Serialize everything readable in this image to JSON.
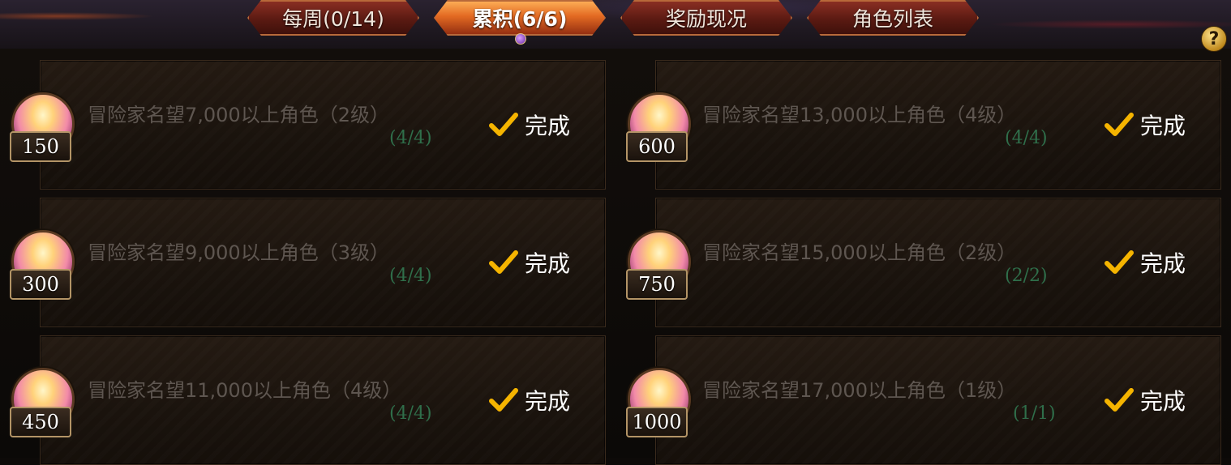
{
  "tabs": [
    {
      "label": "每周(0/14)",
      "active": false
    },
    {
      "label": "累积(6/6)",
      "active": true
    },
    {
      "label": "奖励现况",
      "active": false
    },
    {
      "label": "角色列表",
      "active": false
    }
  ],
  "help": {
    "label": "?"
  },
  "quests": [
    {
      "reward": "150",
      "title": "冒险家名望7,000以上角色（2级）",
      "progress": "(4/4)",
      "status": "完成"
    },
    {
      "reward": "600",
      "title": "冒险家名望13,000以上角色（4级）",
      "progress": "(4/4)",
      "status": "完成"
    },
    {
      "reward": "300",
      "title": "冒险家名望9,000以上角色（3级）",
      "progress": "(4/4)",
      "status": "完成"
    },
    {
      "reward": "750",
      "title": "冒险家名望15,000以上角色（2级）",
      "progress": "(2/2)",
      "status": "完成"
    },
    {
      "reward": "450",
      "title": "冒险家名望11,000以上角色（4级）",
      "progress": "(4/4)",
      "status": "完成"
    },
    {
      "reward": "1000",
      "title": "冒险家名望17,000以上角色（1级）",
      "progress": "(1/1)",
      "status": "完成"
    }
  ],
  "colors": {
    "accent": "#f5b400",
    "progress": "#2f6e4a",
    "title": "#5e5650"
  },
  "icons": {
    "check": "checkmark-icon",
    "medal": "reward-medal-icon",
    "help": "help-icon"
  }
}
